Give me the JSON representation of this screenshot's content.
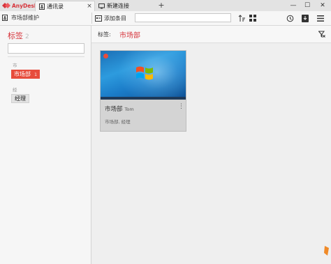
{
  "app": {
    "brand": "AnyDesk"
  },
  "tabs": [
    {
      "label": "通讯录",
      "close": "×"
    },
    {
      "label": "新建连接"
    }
  ],
  "tab_add": "+",
  "window_controls": {
    "minimize": "—",
    "maximize": "☐",
    "close": "✕"
  },
  "toolbar": {
    "addressbook_name": "市场部维护",
    "add_entry_label": "添加条目",
    "search_value": ""
  },
  "sidebar": {
    "title": "标签",
    "count": "2",
    "search_value": "",
    "groups": [
      {
        "letter": "市",
        "tag": "市场部",
        "count": "1",
        "selected": true
      },
      {
        "letter": "经",
        "tag": "经理",
        "selected": false
      }
    ]
  },
  "filter": {
    "label": "标签:",
    "value": "市场部"
  },
  "cards": [
    {
      "name": "市场部",
      "user": "Tom",
      "tags": "市场部, 经理",
      "menu": "⋮",
      "online": false
    }
  ],
  "colors": {
    "accent": "#d6343b",
    "tag_selected": "#e74c3c",
    "status_offline": "#e74c3c"
  },
  "icons": [
    "anydesk-logo-icon",
    "addressbook-tab-icon",
    "monitor-tab-icon",
    "addressbook-icon",
    "add-entry-icon",
    "sort-icon",
    "grid-view-icon",
    "history-icon",
    "download-icon",
    "menu-icon",
    "clear-filter-icon",
    "windows-logo-icon"
  ]
}
